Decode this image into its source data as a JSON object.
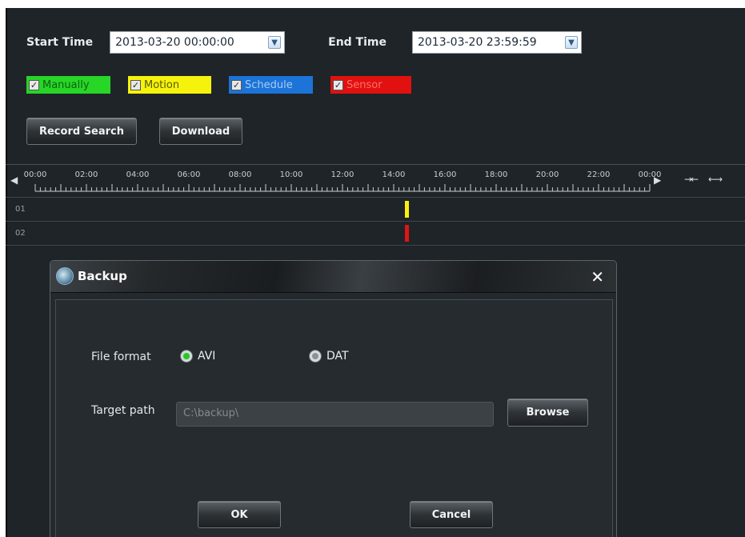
{
  "search": {
    "start_label": "Start Time",
    "start_value": "2013-03-20 00:00:00",
    "end_label": "End Time",
    "end_value": "2013-03-20 23:59:59",
    "types": [
      {
        "label": "Manually",
        "checked": true,
        "color": "#27d627"
      },
      {
        "label": "Motion",
        "checked": true,
        "color": "#f5f30c"
      },
      {
        "label": "Schedule",
        "checked": true,
        "color": "#1c73d8"
      },
      {
        "label": "Sensor",
        "checked": true,
        "color": "#e0110e"
      }
    ],
    "record_search_label": "Record Search",
    "download_label": "Download"
  },
  "timeline": {
    "ticks": [
      "00:00",
      "02:00",
      "04:00",
      "06:00",
      "08:00",
      "10:00",
      "12:00",
      "14:00",
      "16:00",
      "18:00",
      "20:00",
      "22:00",
      "00:00"
    ],
    "tracks": [
      {
        "label": "01",
        "marker_color": "#ffee0d"
      },
      {
        "label": "02",
        "marker_color": "#e01515"
      }
    ],
    "marker_time": "14:00"
  },
  "dialog": {
    "title": "Backup",
    "file_format_label": "File format",
    "format_options": [
      {
        "label": "AVI",
        "selected": true
      },
      {
        "label": "DAT",
        "selected": false
      }
    ],
    "target_path_label": "Target path",
    "target_path_value": "C:\\backup\\",
    "browse_label": "Browse",
    "ok_label": "OK",
    "cancel_label": "Cancel"
  }
}
